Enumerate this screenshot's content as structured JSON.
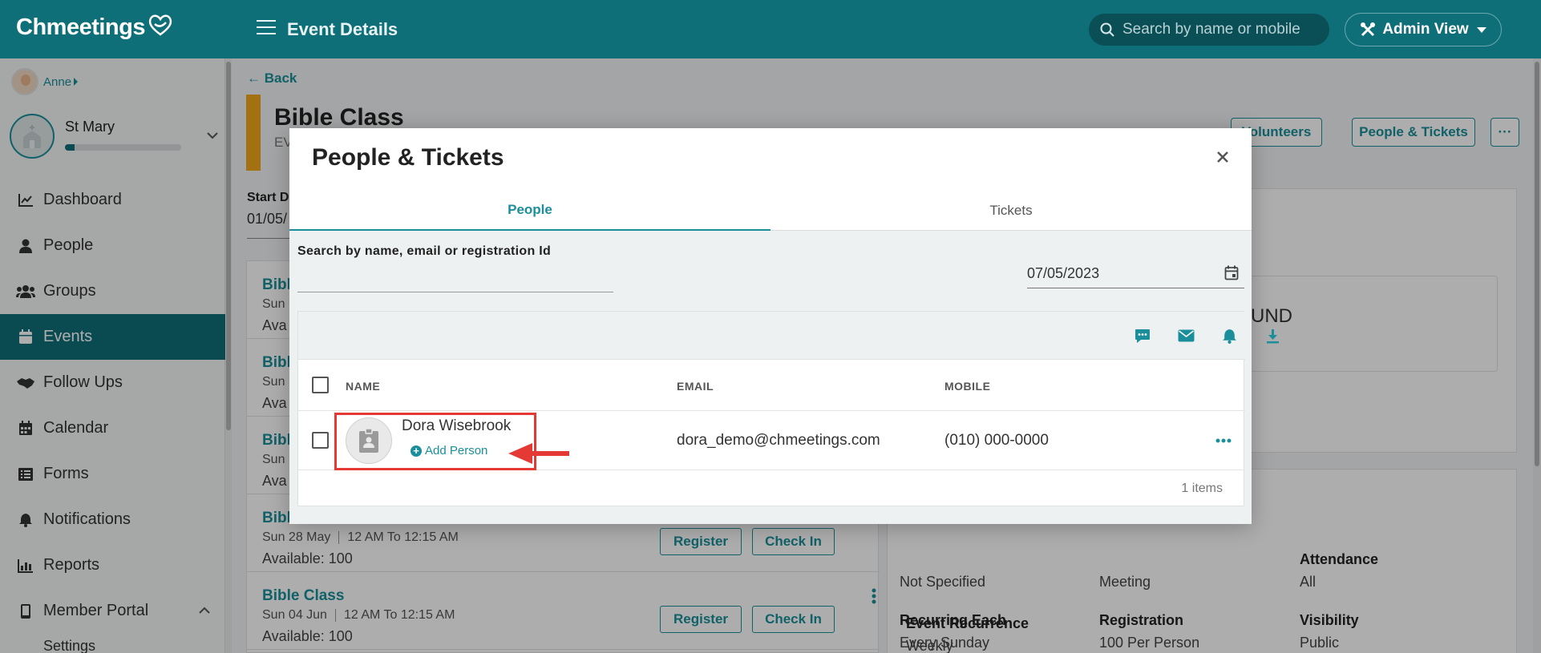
{
  "app": {
    "logo": "Chmeetings",
    "page_title": "Event Details",
    "search_placeholder": "Search by name or mobile",
    "admin_view_label": "Admin View"
  },
  "user": {
    "name": "Anne"
  },
  "church": {
    "name": "St Mary",
    "progress": 0.08
  },
  "nav": {
    "items": [
      {
        "label": "Dashboard",
        "icon": "chart-line-icon"
      },
      {
        "label": "People",
        "icon": "person-icon"
      },
      {
        "label": "Groups",
        "icon": "users-icon"
      },
      {
        "label": "Events",
        "icon": "calendar-icon"
      },
      {
        "label": "Follow Ups",
        "icon": "handshake-icon"
      },
      {
        "label": "Calendar",
        "icon": "calendar-grid-icon"
      },
      {
        "label": "Forms",
        "icon": "form-list-icon"
      },
      {
        "label": "Notifications",
        "icon": "bell-icon"
      },
      {
        "label": "Reports",
        "icon": "bar-chart-icon"
      },
      {
        "label": "Member Portal",
        "icon": "mobile-icon"
      }
    ],
    "sub_items": [
      "Settings"
    ]
  },
  "event": {
    "back_label": "Back",
    "title": "Bible Class",
    "subtitle_visible": "EV",
    "start_label": "Start D",
    "start_value": "01/05/",
    "volunteers_label": "Volunteers",
    "people_tickets_label": "People & Tickets",
    "more_label": "···"
  },
  "occurrences": [
    {
      "title": "Bibl",
      "when": "Sun",
      "available": "Ava"
    },
    {
      "title": "Bibl",
      "when": "Sun",
      "available": "Ava"
    },
    {
      "title": "Bibl",
      "when": "Sun",
      "available": "Ava"
    },
    {
      "title": "Bibl",
      "when": "Sun 28 May",
      "time": "12 AM To 12:15 AM",
      "available": "Available: 100"
    },
    {
      "title": "Bible Class",
      "when": "Sun 04 Jun",
      "time": "12 AM To 12:15 AM",
      "available": "Available: 100"
    }
  ],
  "occurrence_buttons": {
    "register": "Register",
    "check_in": "Check In"
  },
  "details": {
    "partial_und": "UND",
    "not_specified": "Not Specified",
    "meeting": "Meeting",
    "attendance_label": "Attendance",
    "attendance_value": "All",
    "recurring_label": "Recurring Each",
    "recurring_value": "Every Sunday",
    "registration_label": "Registration",
    "registration_value": "100 Per Person",
    "visibility_label": "Visibility",
    "visibility_value": "Public",
    "recurrence_label": "Event Recurrence",
    "recurrence_value": "Weekly"
  },
  "modal": {
    "title": "People & Tickets",
    "tabs": [
      {
        "label": "People",
        "active": true
      },
      {
        "label": "Tickets",
        "active": false
      }
    ],
    "search_label": "Search by name, email or registration Id",
    "search_value": "",
    "date_value": "07/05/2023",
    "columns": {
      "name": "NAME",
      "email": "EMAIL",
      "mobile": "MOBILE"
    },
    "rows": [
      {
        "name": "Dora Wisebrook",
        "add_person_label": "Add Person",
        "email": "dora_demo@chmeetings.com",
        "mobile": "(010) 000-0000"
      }
    ],
    "items_count": "1 items"
  },
  "colors": {
    "brand": "#0e6f78",
    "accent": "#1a8f9b",
    "highlight": "#e53935",
    "title_accent": "#f2a71b"
  }
}
